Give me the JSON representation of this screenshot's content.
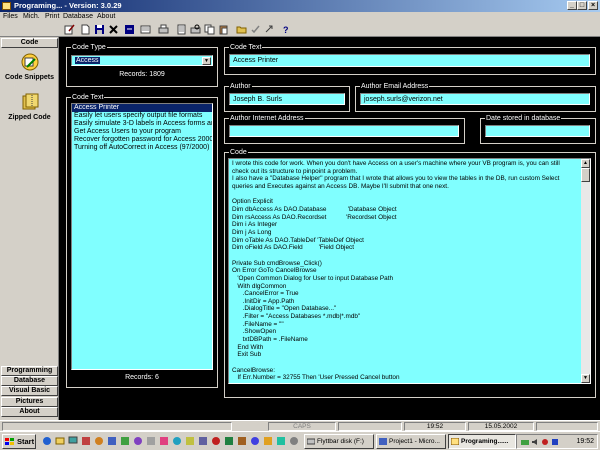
{
  "window": {
    "title": "Programing... - Version: 3.0.29"
  },
  "menu": [
    "Files",
    "Mich.",
    "Print",
    "Database",
    "About"
  ],
  "sidebar": {
    "header": "Code",
    "items": [
      "Code Snippets",
      "Zipped Code"
    ],
    "bottom_buttons": [
      "Programming",
      "Database",
      "Visual Basic",
      "Pictures",
      "About"
    ]
  },
  "code_type": {
    "label": "Code Type",
    "selected": "Access",
    "records": "Records: 1809"
  },
  "code_text_list": {
    "label": "Code Text",
    "items": [
      "Access Printer",
      "Easily let users specify output file formats",
      "Easily simulate 3-D labels in Access forms and rep",
      "Get Access Users to your program",
      "Recover forgotten password for Access 2000",
      "Turning off AutoCorrect in Access (97/2000)"
    ],
    "records": "Records: 6"
  },
  "code_text_field": {
    "label": "Code Text",
    "value": "Access Printer"
  },
  "author": {
    "label": "Author",
    "value": "Joseph B. Surls"
  },
  "author_email": {
    "label": "Author Email Address",
    "value": "joseph.surls@verizon.net"
  },
  "author_internet": {
    "label": "Author Internet Address",
    "value": ""
  },
  "date_stored": {
    "label": "Date stored in database",
    "value": ""
  },
  "code": {
    "label": "Code",
    "lines": [
      "I wrote this code for work. When you don't have Access on a user's machine where your VB program is, you can still",
      "check out its structure to pinpoint a problem.",
      "I also have a \"Database Helper\" program that I wrote that allows you to view the tables in the DB, run custom Select",
      "queries and Executes against an Access DB. Maybe I'll submit that one next.",
      "",
      "Option Explicit",
      "Dim dbAccess As DAO.Database            'Database Object",
      "Dim rsAccess As DAO.Recordset           'Recordset Object",
      "Dim i As Integer",
      "Dim j As Long",
      "Dim oTable As DAO.TableDef 'TableDef Object",
      "Dim oField As DAO.Field         'Field Object",
      "",
      "Private Sub cmdBrowse_Click()",
      "On Error GoTo CancelBrowse",
      "   'Open Common Dialog for User to input Database Path",
      "   With dlgCommon",
      "      .CancelError = True",
      "      .InitDir = App.Path",
      "      .DialogTitle = \"Open Database...\"",
      "      .Filter = \"Access Databases *.mdb|*.mdb\"",
      "      .FileName = \"\"",
      "      .ShowOpen",
      "      txtDBPath = .FileName",
      "   End With",
      "   Exit Sub",
      "",
      "CancelBrowse:",
      "   If Err.Number = 32755 Then 'User Pressed Cancel button"
    ]
  },
  "status": {
    "caps": "CAPS",
    "time": "19:52",
    "date": "15.05.2002"
  },
  "taskbar": {
    "start": "Start",
    "tasks": [
      "Flyttbar disk (F:)",
      "Project1 - Micro...",
      "Programing......"
    ],
    "clock": "19:52"
  }
}
